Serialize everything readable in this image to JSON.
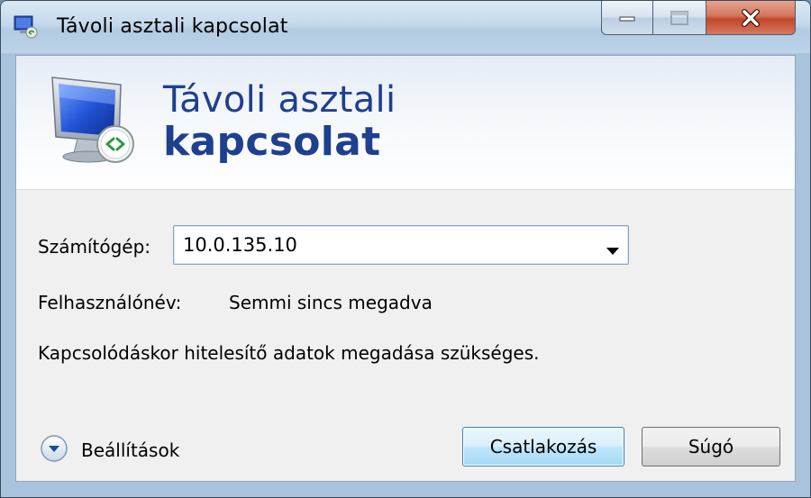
{
  "window": {
    "title": "Távoli asztali kapcsolat",
    "buttons": {
      "minimize": "minimize-icon",
      "maximize": "maximize-icon",
      "close": "close-icon"
    }
  },
  "banner": {
    "line1": "Távoli asztali",
    "line2": "kapcsolat",
    "icon": "remote-desktop-monitor-icon"
  },
  "form": {
    "computer_label": "Számítógép:",
    "computer_value": "10.0.135.10",
    "username_label": "Felhasználónév:",
    "username_value": "Semmi sincs megadva",
    "credentials_note": "Kapcsolódáskor hitelesítő adatok megadása szükséges."
  },
  "footer": {
    "options_label": "Beállítások",
    "connect_label": "Csatlakozás",
    "help_label": "Súgó"
  },
  "colors": {
    "banner_text": "#1f3f8f",
    "default_button_border": "#3c7fb1",
    "close_button": "#c1472a"
  }
}
